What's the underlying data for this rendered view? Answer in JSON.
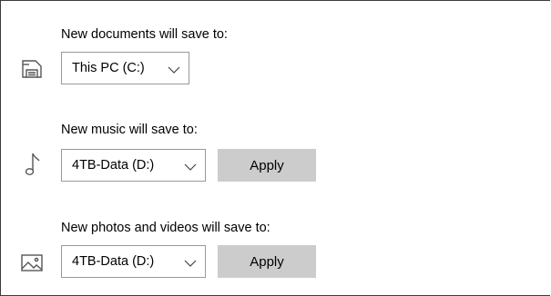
{
  "documents": {
    "label": "New documents will save to:",
    "selected": "This PC (C:)",
    "icon": "drive-icon"
  },
  "music": {
    "label": "New music will save to:",
    "selected": "4TB-Data (D:)",
    "apply_label": "Apply",
    "icon": "music-note-icon"
  },
  "photos": {
    "label": "New photos and videos will save to:",
    "selected": "4TB-Data (D:)",
    "apply_label": "Apply",
    "icon": "picture-icon"
  },
  "colors": {
    "apply_bg": "#cccccc",
    "dropdown_border": "#999999",
    "icon": "#555555"
  }
}
